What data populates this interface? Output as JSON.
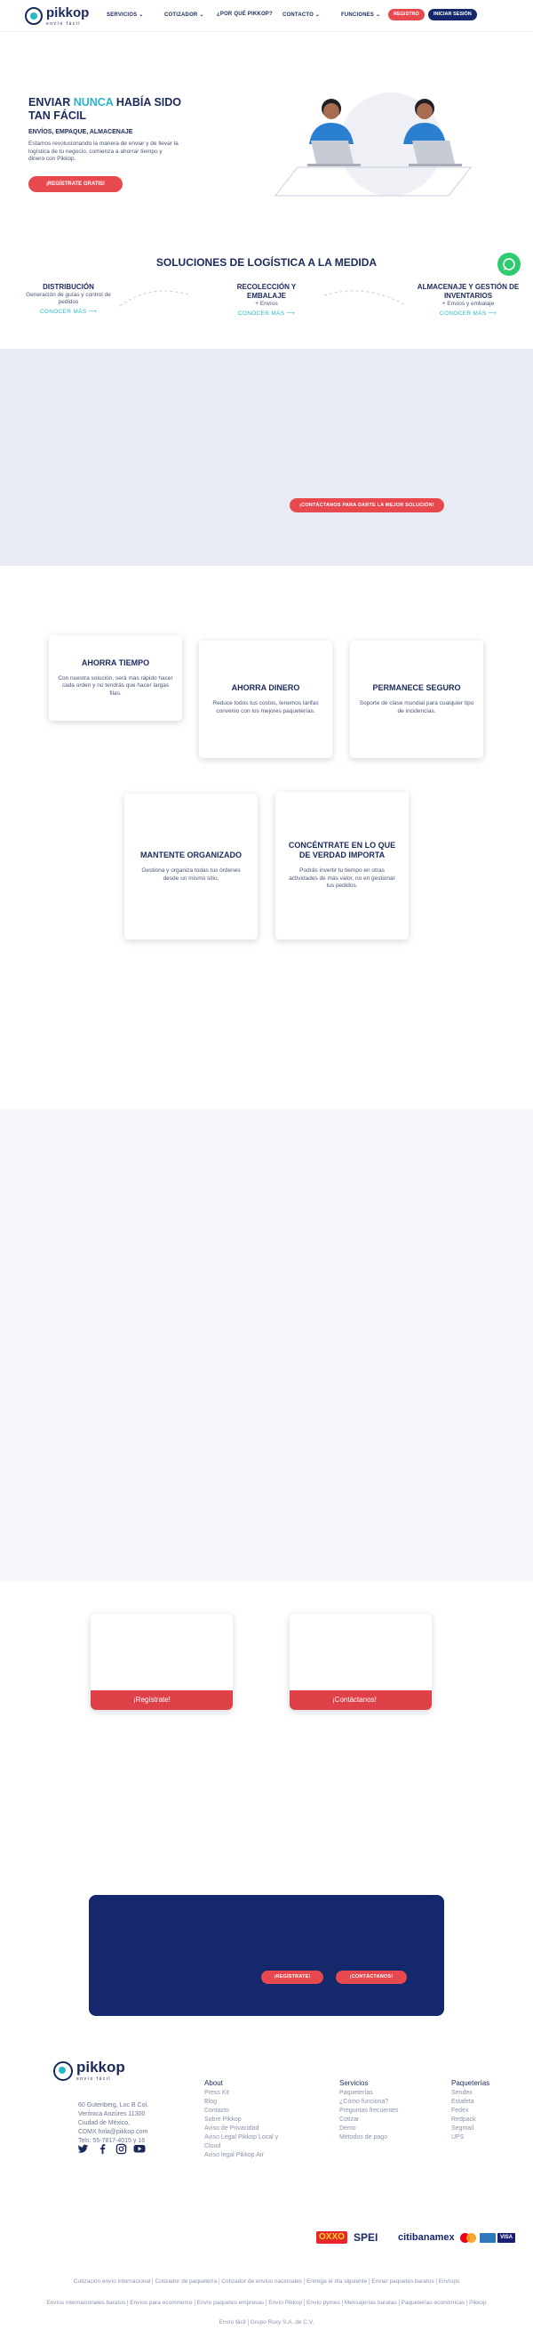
{
  "nav": {
    "brand": "pikkop",
    "brand_sub": "envío fácil",
    "items": [
      "SERVICIOS ⌄",
      "COTIZADOR ⌄",
      "¿POR QUÉ PIKKOP?",
      "CONTACTO ⌄",
      "FUNCIONES ⌄"
    ],
    "register": "REGISTRO",
    "login": "INICIAR SESIÓN"
  },
  "hero": {
    "title_a": "ENVIAR ",
    "title_accent": "NUNCA",
    "title_b": " HABÍA SIDO TAN FÁCIL",
    "subtitle": "ENVÍOS, EMPAQUE, ALMACENAJE",
    "text": "Estamos revolucionando la manera de enviar y de llevar la logística de tu negocio, comienza a ahorrar tiempo y dinero con Pikkop.",
    "cta": "¡REGÍSTRATE GRATIS!"
  },
  "solutions": {
    "title": "SOLUCIONES DE LOGÍSTICA A LA MEDIDA",
    "items": [
      {
        "title": "DISTRIBUCIÓN",
        "desc": "Generación de guías y control de pedidos",
        "link": "CONOCER MÁS ⟶"
      },
      {
        "title": "RECOLECCIÓN Y EMBALAJE",
        "desc": "+ Envíos",
        "link": "CONOCER MÁS ⟶"
      },
      {
        "title": "ALMACENAJE Y GESTIÓN DE INVENTARIOS",
        "desc": "+ Envíos y embalaje",
        "link": "CONOCER MÁS ⟶"
      }
    ]
  },
  "gray_band": {
    "button": "¡CONTÁCTANOS PARA DARTE LA MEJOR SOLUCIÓN!"
  },
  "benefits": [
    {
      "title": "AHORRA TIEMPO",
      "desc": "Con nuestra solución, será más rápido hacer cada orden y no tendrás que hacer largas filas."
    },
    {
      "title": "AHORRA DINERO",
      "desc": "Reduce todos tus costos, tenemos tarifas convenio con los mejores paqueterías."
    },
    {
      "title": "PERMANECE SEGURO",
      "desc": "Soporte de clase mundial para cualquier tipo de incidencias."
    },
    {
      "title": "MANTENTE ORGANIZADO",
      "desc": "Gestiona y organiza todas tus órdenes desde un mismo sitio."
    },
    {
      "title": "CONCÉNTRATE EN LO QUE DE VERDAD IMPORTA",
      "desc": "Podrás invertir tu tiempo en otras actividades de más valor, no en gestionar tus pedidos."
    }
  ],
  "cta_cards": [
    "¡Regístrate!",
    "¡Contáctanos!"
  ],
  "blue_panel": {
    "btn_register": "¡REGÍSTRATE!",
    "btn_contact": "¡CONTÁCTANOS!"
  },
  "footer": {
    "brand": "pikkop",
    "brand_sub": "envío fácil",
    "address": "60 Gutenberg, Loc B Col. Verónica Anzúres 11300 Ciudad de México, CDMX hola@pikkop.com Tels: 55-7817-4015 y 16",
    "columns": [
      {
        "heading": "About",
        "items": [
          "Press Kit",
          "Blog",
          "Contacto",
          "Sobre Pikkop",
          "Aviso de Privacidad",
          "Aviso Legal Pikkop Local y Cloud",
          "Aviso legal Pikkop Air"
        ]
      },
      {
        "heading": "Servicios",
        "items": [
          "Paqueterías",
          "¿Cómo funciona?",
          "Preguntas frecuentes",
          "Cotizar",
          "Demo",
          "Métodos de pago"
        ]
      },
      {
        "heading": "Paqueterías",
        "items": [
          "Sendex",
          "Estafeta",
          "Fedex",
          "Redpack",
          "Segmail",
          "UPS"
        ]
      }
    ],
    "payments": [
      "OXXO",
      "SPEI",
      "citibanamex",
      "mc",
      "VISA"
    ],
    "links_row1": [
      "Cotización envío internacional",
      "Cotizador de paquetería",
      "Cotizador de envíos nacionales",
      "Entrega el día siguiente",
      "Enviar paquetes baratos",
      "Envíops"
    ],
    "links_row2": [
      "Envíos internacionales baratos",
      "Envíos para ecommerce",
      "Envío paquetes empresas",
      "Envío Pikkop",
      "Envío pymes",
      "Mensajerías baratas",
      "Paqueterías económicas",
      "Pikkop"
    ],
    "links_row3": [
      "Envío fácil",
      "Grupo Ruxy S.A. de C.V."
    ]
  }
}
